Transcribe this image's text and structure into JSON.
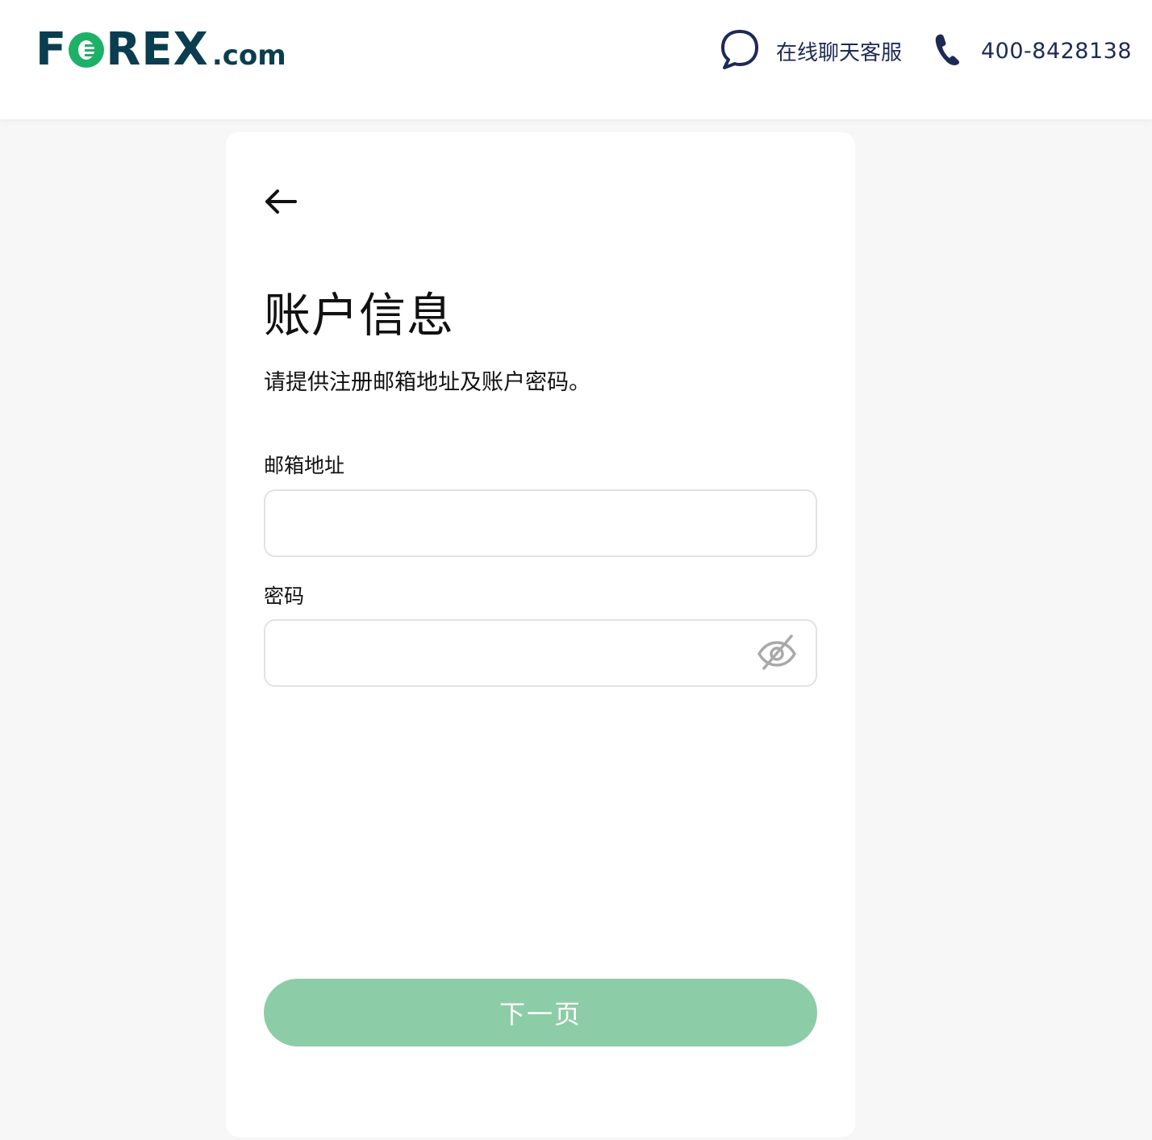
{
  "header": {
    "logo": {
      "brand_left": "F",
      "brand_right": "REX",
      "suffix": ".com",
      "text": "FOREX.com"
    },
    "chat": {
      "icon": "chat-bubble-icon",
      "label": "在线聊天客服"
    },
    "phone": {
      "icon": "phone-icon",
      "label": "400-8428138"
    }
  },
  "form": {
    "back_icon": "arrow-left-icon",
    "title": "账户信息",
    "subtitle": "请提供注册邮箱地址及账户密码。",
    "email": {
      "label": "邮箱地址",
      "value": "",
      "placeholder": ""
    },
    "password": {
      "label": "密码",
      "value": "",
      "placeholder": "",
      "toggle_icon": "eye-off-icon"
    },
    "next_button": "下一页"
  },
  "colors": {
    "brand_dark": "#0a3d4f",
    "brand_green": "#1db067",
    "header_text": "#1d2a55",
    "button_disabled": "#8ccca6",
    "page_background": "#f7f7f7"
  }
}
